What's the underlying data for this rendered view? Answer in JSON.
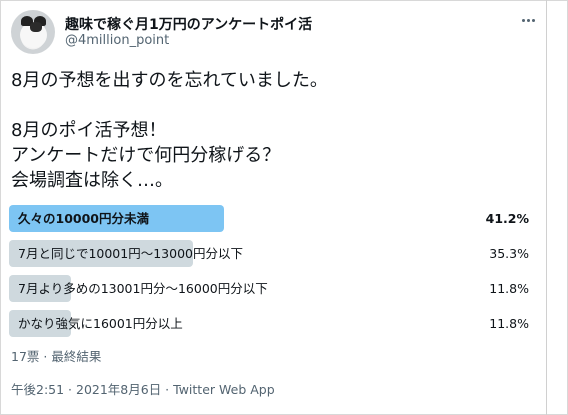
{
  "author": {
    "display_name": "趣味で稼ぐ月1万円のアンケートポイ活",
    "handle": "@4million_point",
    "avatar_icon": "cat-avatar-icon"
  },
  "menu_icon": "more-options-icon",
  "tweet": {
    "lines": [
      "8月の予想を出すのを忘れていました。",
      "",
      "8月のポイ活予想！",
      "アンケートだけで何円分稼げる？",
      "会場調査は除く…。"
    ]
  },
  "poll": {
    "options": [
      {
        "label": "久々の10000円分未満",
        "percent_text": "41.2%",
        "percent": 41.2,
        "winner": true
      },
      {
        "label": "7月と同じで10001円～13000円分以下",
        "percent_text": "35.3%",
        "percent": 35.3,
        "winner": false
      },
      {
        "label": "7月より多めの13001円分～16000円分以下",
        "percent_text": "11.8%",
        "percent": 11.8,
        "winner": false
      },
      {
        "label": "かなり強気に16001円分以上",
        "percent_text": "11.8%",
        "percent": 11.8,
        "winner": false
      }
    ],
    "meta": "17票 · 最終結果"
  },
  "timestamp": "午後2:51 · 2021年8月6日 · Twitter Web App",
  "colors": {
    "winner_bar": "#7dc5f3",
    "other_bar": "#cfd9de",
    "secondary_text": "#536471"
  }
}
